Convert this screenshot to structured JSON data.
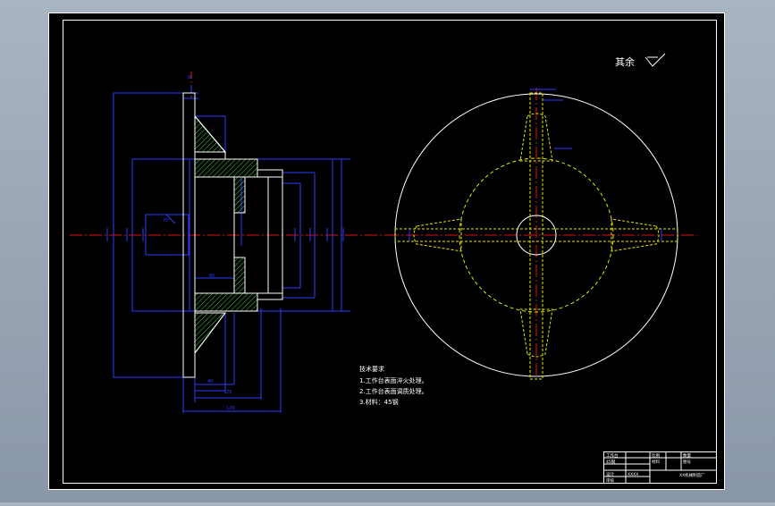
{
  "drawing": {
    "roughness_note": "其余",
    "tech_requirements": {
      "title": "技术要求",
      "items": [
        "1.工作台表面淬火处理。",
        "2.工作台表面调质处理。",
        "3.材料：45钢"
      ]
    },
    "title_block": {
      "cells": [
        "工作台",
        "45钢",
        "比例",
        "数量",
        "材料",
        "图号",
        "XXXX",
        "设计",
        "审核",
        "XX机械制造厂"
      ]
    }
  },
  "colors": {
    "sheet": "#000000",
    "frame": "#ffffff",
    "outline": "#ffffff",
    "dimension": "#2b3cff",
    "centerline": "#e01010",
    "hidden": "#e6e600",
    "hatch": "#3cd43c",
    "text": "#ffffff"
  },
  "icons": {
    "roughness": "surface-roughness-symbol"
  }
}
